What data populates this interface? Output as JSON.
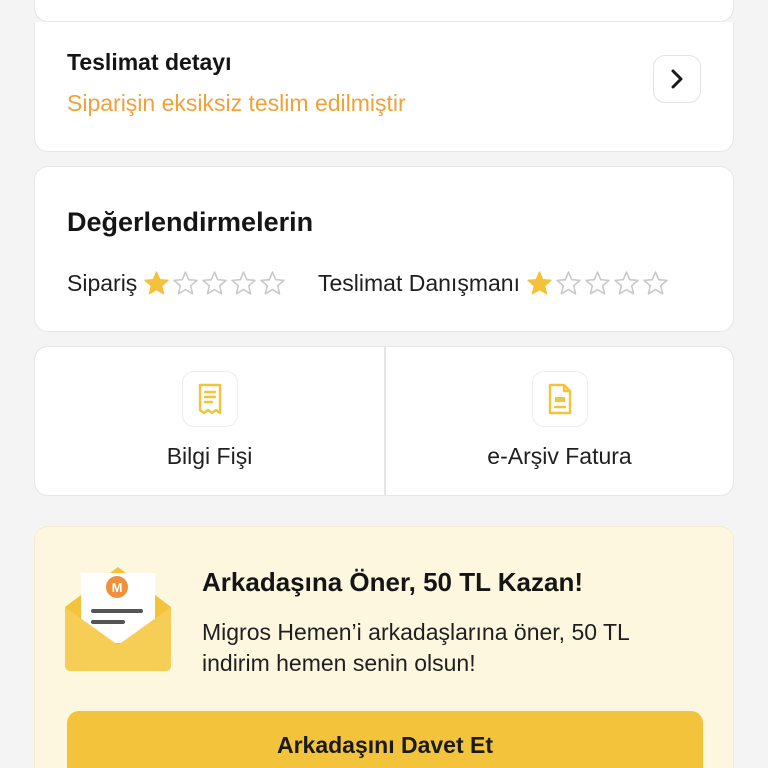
{
  "delivery": {
    "title": "Teslimat detayı",
    "status": "Siparişin eksiksiz teslim edilmiştir"
  },
  "ratings": {
    "title": "Değerlendirmelerin",
    "items": [
      {
        "label": "Sipariş",
        "rating": 1,
        "max": 5
      },
      {
        "label": "Teslimat Danışmanı",
        "rating": 1,
        "max": 5
      }
    ]
  },
  "documents": {
    "items": [
      {
        "label": "Bilgi Fişi",
        "icon": "receipt-icon"
      },
      {
        "label": "e-Arşiv Fatura",
        "icon": "invoice-icon"
      }
    ]
  },
  "referral": {
    "title": "Arkadaşına Öner, 50 TL Kazan!",
    "description": "Migros Hemen’i arkadaşlarına öner, 50 TL indirim hemen senin olsun!",
    "badge_letter": "M",
    "button_label": "Arkadaşını Davet Et"
  },
  "colors": {
    "accent_orange": "#f0a13a",
    "star_filled": "#f5c03a",
    "star_empty": "#c9c9cc",
    "referral_bg": "#fdf7df",
    "button_yellow": "#f3c33c"
  }
}
